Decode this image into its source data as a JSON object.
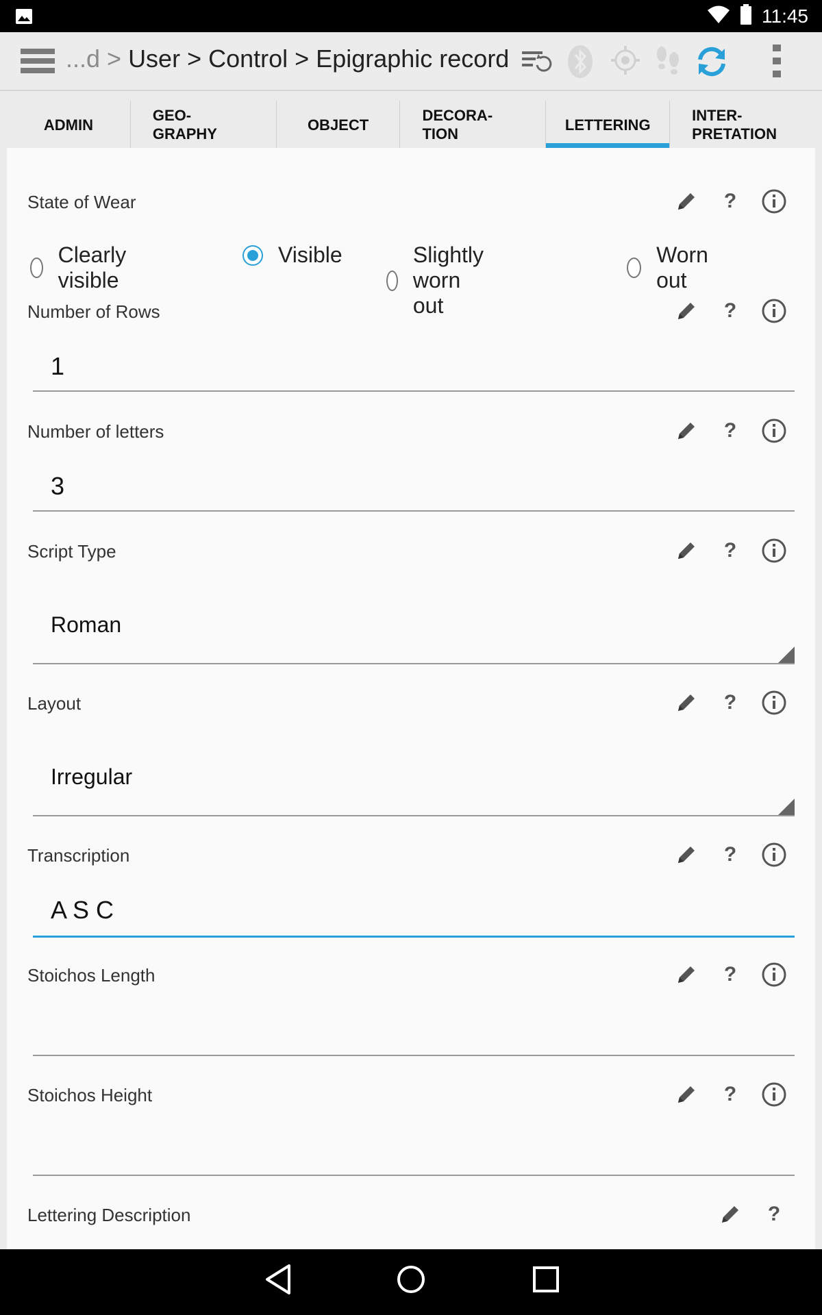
{
  "status_bar": {
    "time": "11:45"
  },
  "action_bar": {
    "breadcrumb_prefix": "...d > ",
    "breadcrumb_path": "User > Control > Epigraphic record"
  },
  "tabs": [
    {
      "label_line1": "ADMIN",
      "label_line2": ""
    },
    {
      "label_line1": "GEO-",
      "label_line2": "GRAPHY"
    },
    {
      "label_line1": "OBJECT",
      "label_line2": ""
    },
    {
      "label_line1": "DECORA-",
      "label_line2": "TION"
    },
    {
      "label_line1": "LETTERING",
      "label_line2": ""
    },
    {
      "label_line1": "INTER-",
      "label_line2": "PRETATION"
    }
  ],
  "form": {
    "state_of_wear": {
      "label": "State of Wear",
      "options": [
        "Clearly visible",
        "Visible",
        "Slightly worn out",
        "Worn out"
      ],
      "selected": "Visible"
    },
    "number_of_rows": {
      "label": "Number of Rows",
      "value": "1"
    },
    "number_of_letters": {
      "label": "Number of letters",
      "value": "3"
    },
    "script_type": {
      "label": "Script Type",
      "value": "Roman"
    },
    "layout": {
      "label": "Layout",
      "value": "Irregular"
    },
    "transcription": {
      "label": "Transcription",
      "value": "A S C"
    },
    "stoichos_length": {
      "label": "Stoichos Length",
      "value": ""
    },
    "stoichos_height": {
      "label": "Stoichos Height",
      "value": ""
    },
    "lettering_description": {
      "label": "Lettering Description"
    }
  },
  "field_icon_glyphs": {
    "help": "?",
    "info": "i"
  },
  "colors": {
    "accent": "#2aa0d8"
  }
}
